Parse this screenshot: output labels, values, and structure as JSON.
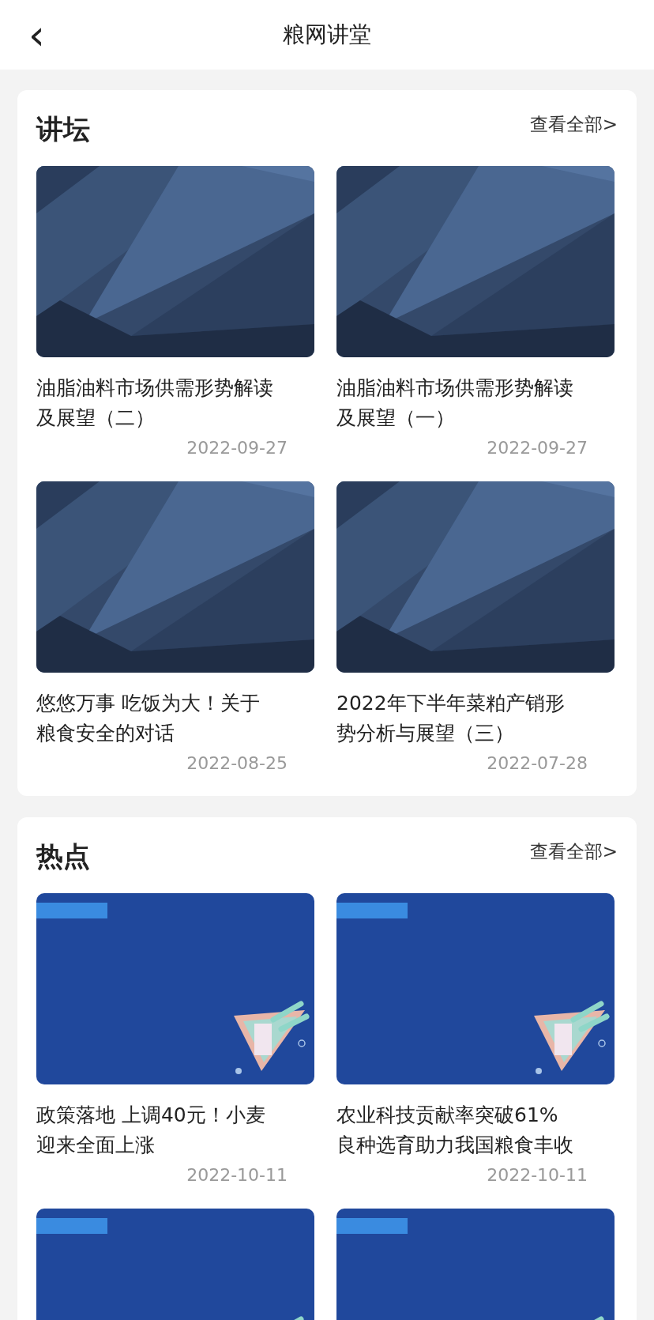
{
  "header": {
    "back": "‹",
    "title": "粮网讲堂"
  },
  "sections": [
    {
      "title": "讲坛",
      "more": "查看全部>",
      "items": [
        {
          "kind": "forum",
          "title": "油脂油料市场供需形势解读及展望（二）",
          "date": "2022-09-27"
        },
        {
          "kind": "forum",
          "title": "油脂油料市场供需形势解读及展望（一）",
          "date": "2022-09-27"
        },
        {
          "kind": "forum",
          "title": "悠悠万事 吃饭为大！关于粮食安全的对话",
          "date": "2022-08-25"
        },
        {
          "kind": "forum",
          "title": "2022年下半年菜粕产销形势分析与展望（三）",
          "date": "2022-07-28"
        }
      ]
    },
    {
      "title": "热点",
      "more": "查看全部>",
      "items": [
        {
          "kind": "hot",
          "title": "政策落地 上调40元！小麦迎来全面上涨",
          "date": "2022-10-11"
        },
        {
          "kind": "hot",
          "title": "农业科技贡献率突破61%\n良种选育助力我国粮食丰收",
          "date": "2022-10-11"
        },
        {
          "kind": "hot"
        },
        {
          "kind": "hot"
        }
      ]
    }
  ]
}
